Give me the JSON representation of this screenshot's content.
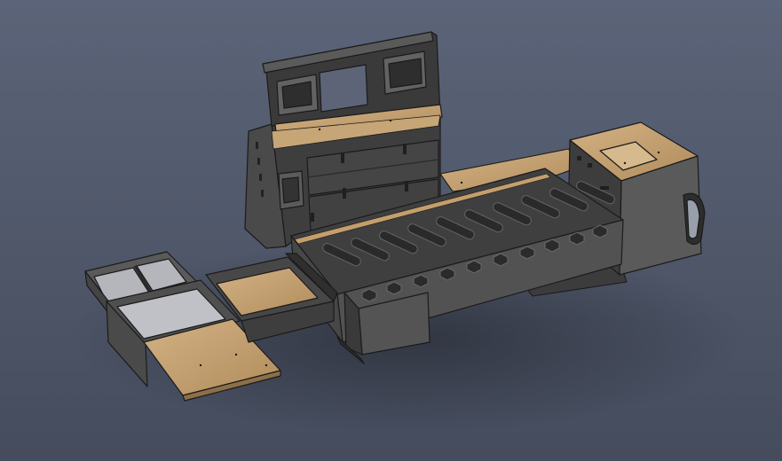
{
  "scene": {
    "subject": "",
    "colors": {
      "background_top": "#5b6478",
      "background_bottom": "#444b5c",
      "panel_dark": "#3d3d3d",
      "panel_mid": "#575757",
      "panel_light": "#6d6d6d",
      "wood": "#c7a577",
      "wood_dark": "#a98656",
      "line": "#1b1b1b",
      "interior_light": "#b9b9bf"
    }
  }
}
